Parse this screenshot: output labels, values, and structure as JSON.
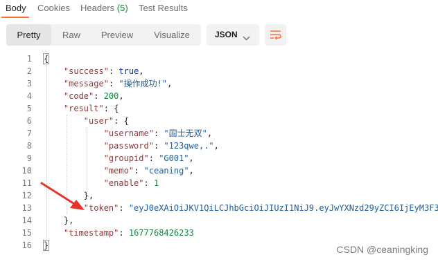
{
  "tabs": {
    "body": "Body",
    "cookies": "Cookies",
    "headers": "Headers",
    "headers_count": "(5)",
    "test_results": "Test Results",
    "active": "Body"
  },
  "toolbar": {
    "modes": [
      "Pretty",
      "Raw",
      "Preview",
      "Visualize"
    ],
    "active_mode": "Pretty",
    "format": "JSON",
    "wrap_icon": "wrap-lines-icon"
  },
  "editor": {
    "line_numbers": [
      "1",
      "2",
      "3",
      "4",
      "5",
      "6",
      "7",
      "8",
      "9",
      "10",
      "11",
      "12",
      "13",
      "14",
      "15",
      "16"
    ],
    "success_key": "\"success\"",
    "success_val": "true",
    "message_key": "\"message\"",
    "message_val": "\"操作成功!\"",
    "code_key": "\"code\"",
    "code_val": "200",
    "result_key": "\"result\"",
    "user_key": "\"user\"",
    "username_key": "\"username\"",
    "username_val": "\"国士无双\"",
    "password_key": "\"password\"",
    "password_val": "\"123qwe,.\"",
    "groupid_key": "\"groupid\"",
    "groupid_val": "\"G001\"",
    "memo_key": "\"memo\"",
    "memo_val": "\"ceaning\"",
    "enable_key": "\"enable\"",
    "enable_val": "1",
    "token_key": "\"token\"",
    "token_val": "\"eyJ0eXAiOiJKV1QiLCJhbGciOiJIUzI1NiJ9.eyJwYXNzd29yZCI6IjEyM3F3",
    "timestamp_key": "\"timestamp\"",
    "timestamp_val": "1677768426233"
  },
  "annotation": {
    "arrow_color": "#e8322a"
  },
  "watermark": "CSDN @ceaningking",
  "colors": {
    "accent": "#ff6c37",
    "key": "#8a3d3d",
    "string": "#1f5c9c",
    "number": "#0f8a3b",
    "literal": "#0c2f9b"
  }
}
